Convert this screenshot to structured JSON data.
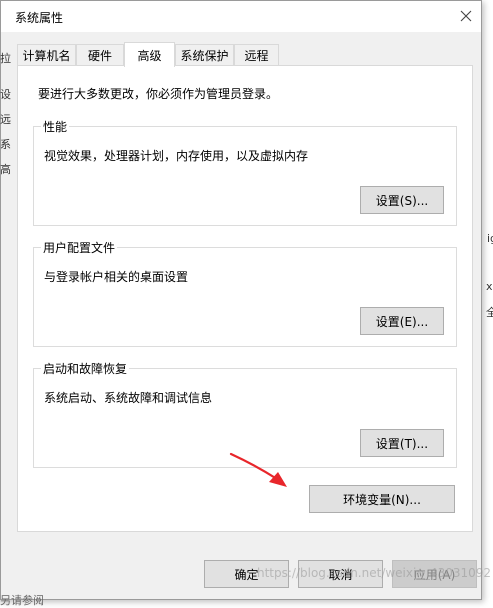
{
  "window": {
    "title": "系统属性",
    "close_icon": "close-icon"
  },
  "tabs": [
    {
      "label": "计算机名",
      "active": false
    },
    {
      "label": "硬件",
      "active": false
    },
    {
      "label": "高级",
      "active": true
    },
    {
      "label": "系统保护",
      "active": false
    },
    {
      "label": "远程",
      "active": false
    }
  ],
  "advanced": {
    "intro": "要进行大多数更改，你必须作为管理员登录。",
    "performance": {
      "label": "性能",
      "description": "视觉效果，处理器计划，内存使用，以及虚拟内存",
      "button": "设置(S)..."
    },
    "user_profiles": {
      "label": "用户配置文件",
      "description": "与登录帐户相关的桌面设置",
      "button": "设置(E)..."
    },
    "startup_recovery": {
      "label": "启动和故障恢复",
      "description": "系统启动、系统故障和调试信息",
      "button": "设置(T)..."
    },
    "env_button": "环境变量(N)..."
  },
  "footer": {
    "ok": "确定",
    "cancel": "取消",
    "apply": "应用(A)"
  },
  "background": {
    "left_fragments": [
      "拉",
      "设",
      "远",
      "系",
      "高"
    ],
    "right_fragments": [
      "ig",
      "x6",
      "全"
    ],
    "bottom_fragment": "另请参阅",
    "watermark": "https://blog.csdn.net/weixin_43031092"
  },
  "colors": {
    "dialog_bg": "#f0f0f0",
    "panel_bg": "#ffffff",
    "arrow": "#e8262b"
  }
}
